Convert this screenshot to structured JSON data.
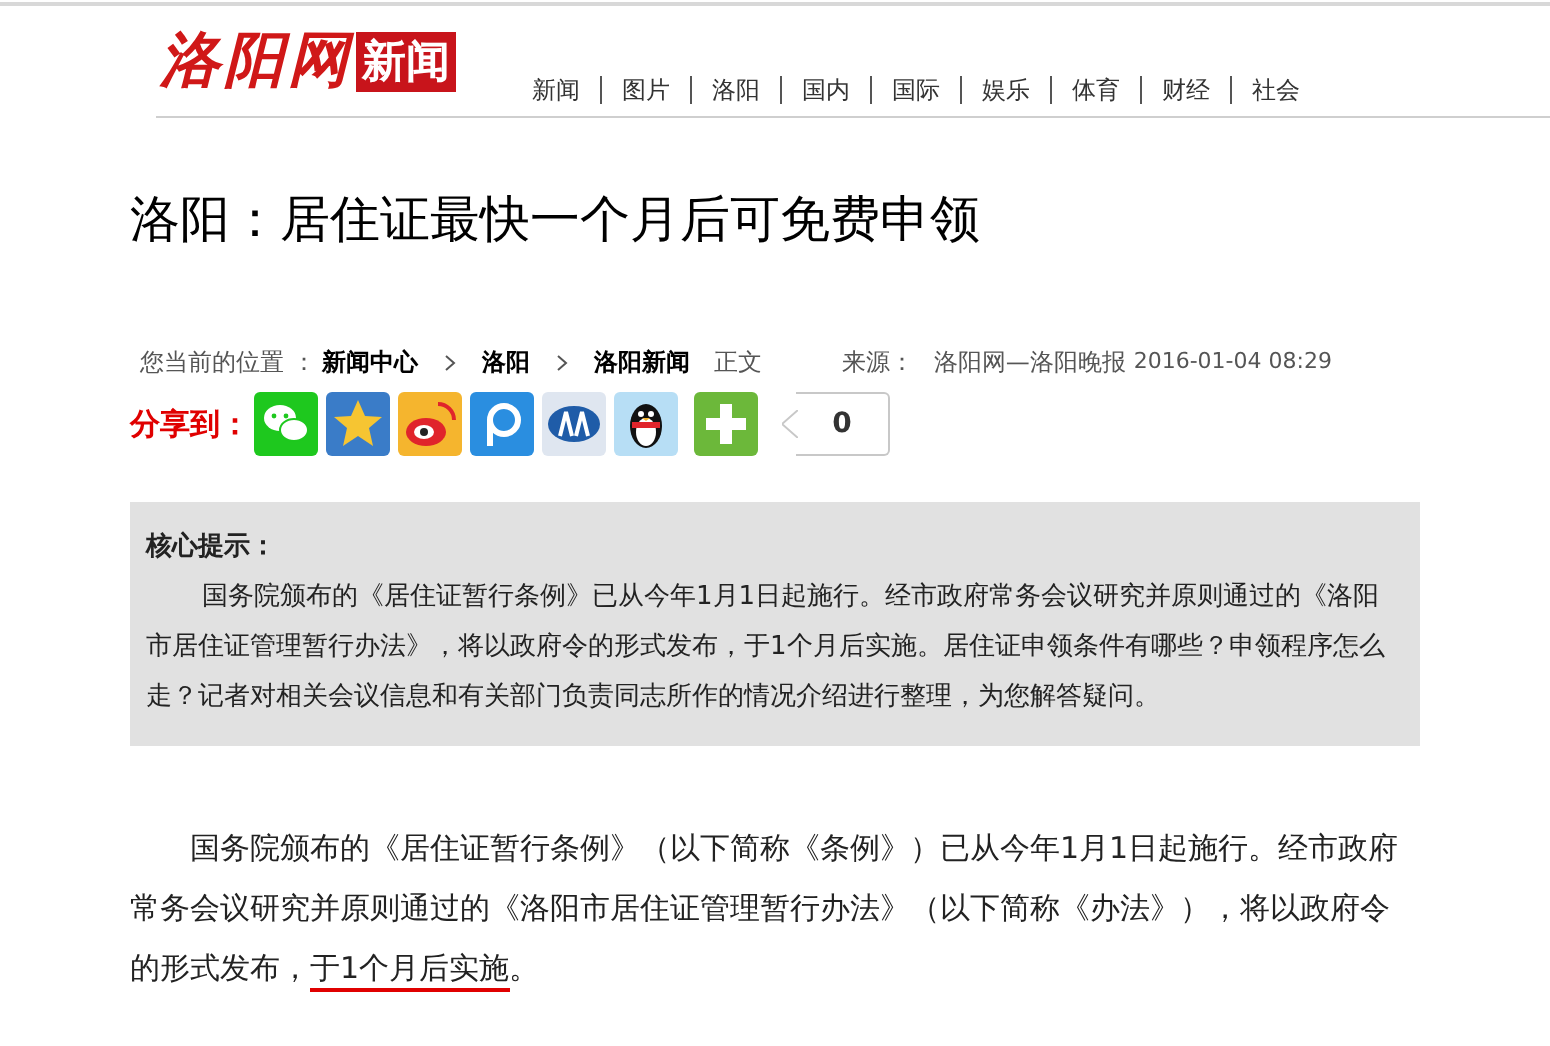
{
  "header": {
    "logo_text": "洛阳网",
    "logo_badge": "新闻",
    "nav": [
      "新闻",
      "图片",
      "洛阳",
      "国内",
      "国际",
      "娱乐",
      "体育",
      "财经",
      "社会"
    ]
  },
  "article": {
    "title": "洛阳：居住证最快一个月后可免费申领",
    "breadcrumb": {
      "label": "您当前的位置 ：",
      "items": [
        "新闻中心",
        "洛阳",
        "洛阳新闻"
      ],
      "current": "正文"
    },
    "source_label": "来源：",
    "source": "洛阳网—洛阳晚报",
    "date": "2016-01-04 08:29",
    "share": {
      "label": "分享到：",
      "services": [
        {
          "kind": "wechat"
        },
        {
          "kind": "qzone"
        },
        {
          "kind": "weibo"
        },
        {
          "kind": "pengyou"
        },
        {
          "kind": "renren"
        },
        {
          "kind": "qq"
        },
        {
          "kind": "more"
        }
      ],
      "count": "0"
    },
    "summary": {
      "heading": "核心提示：",
      "text": "国务院颁布的《居住证暂行条例》已从今年1月1日起施行。经市政府常务会议研究并原则通过的《洛阳市居住证管理暂行办法》，将以政府令的形式发布，于1个月后实施。居住证申领条件有哪些？申领程序怎么走？记者对相关会议信息和有关部门负责同志所作的情况介绍进行整理，为您解答疑问。"
    },
    "paragraph": {
      "before": "国务院颁布的《居住证暂行条例》（以下简称《条例》）已从今年1月1日起施行。经市政府常务会议研究并原则通过的《洛阳市居住证管理暂行办法》（以下简称《办法》），将以政府令的形式发布，",
      "underlined": "于1个月后实施",
      "after": "。"
    }
  }
}
